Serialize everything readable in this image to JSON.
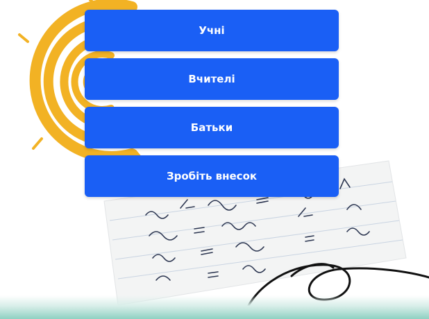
{
  "buttons": [
    {
      "label": "Учні"
    },
    {
      "label": "Вчителі"
    },
    {
      "label": "Батьки"
    },
    {
      "label": "Зробіть внесок"
    }
  ],
  "colors": {
    "button_bg": "#1a5ff5",
    "button_text": "#ffffff",
    "sun_yellow": "#f2b224",
    "band_teal": "#8fd1c2"
  },
  "decor": {
    "sun_icon": "sun-scribble-icon",
    "paper_icon": "math-paper-icon",
    "swirl_icon": "ink-swirl-icon"
  }
}
